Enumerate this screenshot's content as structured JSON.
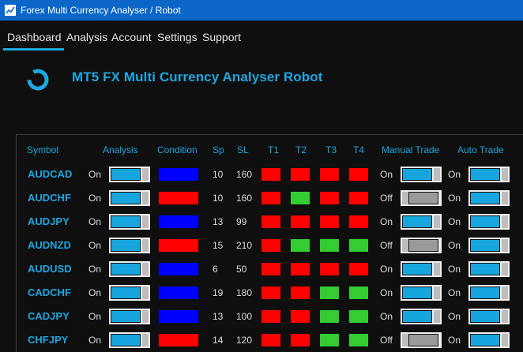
{
  "window": {
    "title": "Forex Multi Currency Analyser / Robot"
  },
  "menu": [
    "Dashboard",
    "Analysis",
    "Account",
    "Settings",
    "Support"
  ],
  "app_title": "MT5 FX Multi Currency Analyser Robot",
  "colors": {
    "accent": "#1ea7e0",
    "red": "#ff0000",
    "green": "#33cc33",
    "blue": "#0000ff",
    "toggle_on": "#17a5de",
    "toggle_off": "#9a9a9a"
  },
  "table": {
    "headers": {
      "symbol": "Symbol",
      "analysis": "Analysis",
      "condition": "Condition",
      "sp": "Sp",
      "sl": "SL",
      "t1": "T1",
      "t2": "T2",
      "t3": "T3",
      "t4": "T4",
      "manual": "Manual Trade",
      "auto": "Auto Trade"
    },
    "rows": [
      {
        "symbol": "AUDCAD",
        "analysis": "On",
        "condition": "blue",
        "sp": "10",
        "sl": "160",
        "t": [
          "red",
          "red",
          "red",
          "red"
        ],
        "manual": "On",
        "auto": "On"
      },
      {
        "symbol": "AUDCHF",
        "analysis": "On",
        "condition": "red",
        "sp": "10",
        "sl": "160",
        "t": [
          "red",
          "green",
          "red",
          "red"
        ],
        "manual": "Off",
        "auto": "On"
      },
      {
        "symbol": "AUDJPY",
        "analysis": "On",
        "condition": "blue",
        "sp": "13",
        "sl": "99",
        "t": [
          "red",
          "red",
          "red",
          "red"
        ],
        "manual": "On",
        "auto": "On"
      },
      {
        "symbol": "AUDNZD",
        "analysis": "On",
        "condition": "red",
        "sp": "15",
        "sl": "210",
        "t": [
          "red",
          "green",
          "green",
          "green"
        ],
        "manual": "Off",
        "auto": "On"
      },
      {
        "symbol": "AUDUSD",
        "analysis": "On",
        "condition": "blue",
        "sp": "6",
        "sl": "50",
        "t": [
          "red",
          "red",
          "red",
          "red"
        ],
        "manual": "On",
        "auto": "On"
      },
      {
        "symbol": "CADCHF",
        "analysis": "On",
        "condition": "blue",
        "sp": "19",
        "sl": "180",
        "t": [
          "red",
          "red",
          "green",
          "green"
        ],
        "manual": "On",
        "auto": "On"
      },
      {
        "symbol": "CADJPY",
        "analysis": "On",
        "condition": "blue",
        "sp": "13",
        "sl": "100",
        "t": [
          "red",
          "red",
          "green",
          "green"
        ],
        "manual": "On",
        "auto": "On"
      },
      {
        "symbol": "CHFJPY",
        "analysis": "On",
        "condition": "red",
        "sp": "14",
        "sl": "120",
        "t": [
          "red",
          "red",
          "green",
          "green"
        ],
        "manual": "Off",
        "auto": "On"
      }
    ]
  }
}
